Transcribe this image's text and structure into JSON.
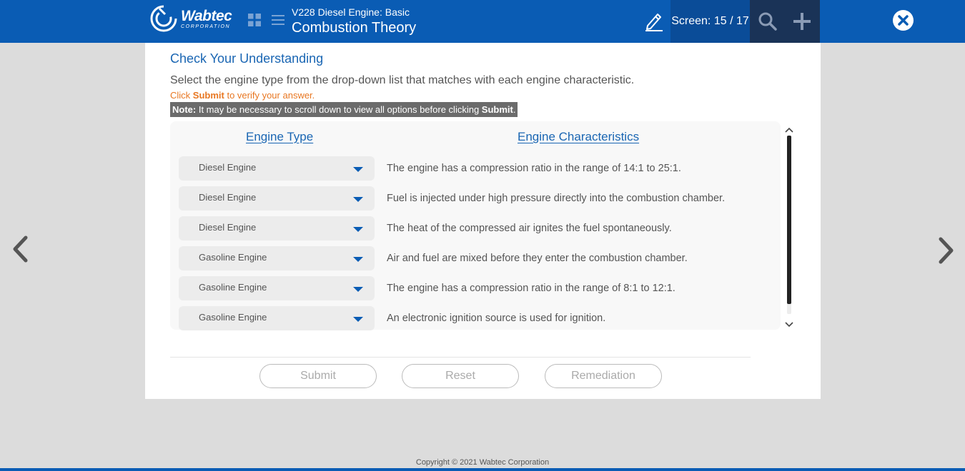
{
  "header": {
    "logo_name": "Wabtec",
    "logo_corp": "CORPORATION",
    "course_subtitle": "V228 Diesel Engine: Basic",
    "course_title": "Combustion Theory",
    "screen_counter": "Screen: 15 / 17",
    "colors": {
      "bar": "#0a5cb4",
      "screen_box": "#0a4c98",
      "tools_box": "#1a3357"
    }
  },
  "content": {
    "title": "Check Your Understanding",
    "instruction": "Select the engine type from the drop-down list that matches with each engine characteristic.",
    "click_prefix": "Click ",
    "click_bold": "Submit",
    "click_suffix": " to verify your answer.",
    "note_bold": "Note:",
    "note_text": " It may be necessary to scroll down to view all options before clicking ",
    "note_end_bold": "Submit",
    "note_end": ".",
    "col_engine_type": "Engine Type",
    "col_engine_characteristics": "Engine Characteristics",
    "rows": [
      {
        "selected": "Diesel Engine",
        "characteristic": "The engine has a compression ratio in the range of 14:1 to 25:1."
      },
      {
        "selected": "Diesel Engine",
        "characteristic": "Fuel is injected under high pressure directly into the combustion chamber."
      },
      {
        "selected": "Diesel Engine",
        "characteristic": "The heat of the compressed air ignites the fuel spontaneously."
      },
      {
        "selected": "Gasoline Engine",
        "characteristic": "Air and fuel are mixed before they enter the combustion chamber."
      },
      {
        "selected": "Gasoline Engine",
        "characteristic": "The engine has a compression ratio in the range of 8:1 to 12:1."
      },
      {
        "selected": "Gasoline Engine",
        "characteristic": "An electronic ignition source is used for ignition."
      }
    ],
    "buttons": {
      "submit": "Submit",
      "reset": "Reset",
      "remediation": "Remediation"
    }
  },
  "footer": {
    "copyright": "Copyright © 2021 Wabtec Corporation"
  }
}
